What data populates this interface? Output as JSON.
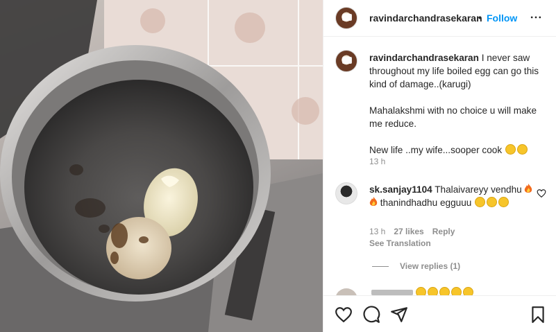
{
  "post": {
    "image_alt_icon": "photo-boiled-eggs-in-steel-pot"
  },
  "header": {
    "username": "ravindarchandrasekaran",
    "separator": "•",
    "follow_label": "Follow",
    "more_icon": "more-horizontal-icon"
  },
  "caption": {
    "username": "ravindarchandrasekaran",
    "line1": " I never saw throughout my life boiled egg can go this kind of damage..(karugi)",
    "line2": "Mahalakshmi with no choice u will make me reduce.",
    "line3": "New life ..my wife...sooper cook ",
    "time": "13 h"
  },
  "comments": [
    {
      "username": "sk.sanjay1104",
      "text1": " Thalaivareyy vendhu ",
      "text2": " thanindhadhu egguuu ",
      "time": "13 h",
      "likes": "27 likes",
      "reply_label": "Reply",
      "translate_label": "See Translation",
      "view_replies": "View replies (1)"
    }
  ],
  "colors": {
    "accent": "#0095f6",
    "muted": "#8e8e8e",
    "text": "#262626",
    "border": "#efefef"
  },
  "actions": {
    "like_icon": "heart-icon",
    "comment_icon": "comment-icon",
    "share_icon": "send-icon",
    "save_icon": "bookmark-icon"
  }
}
